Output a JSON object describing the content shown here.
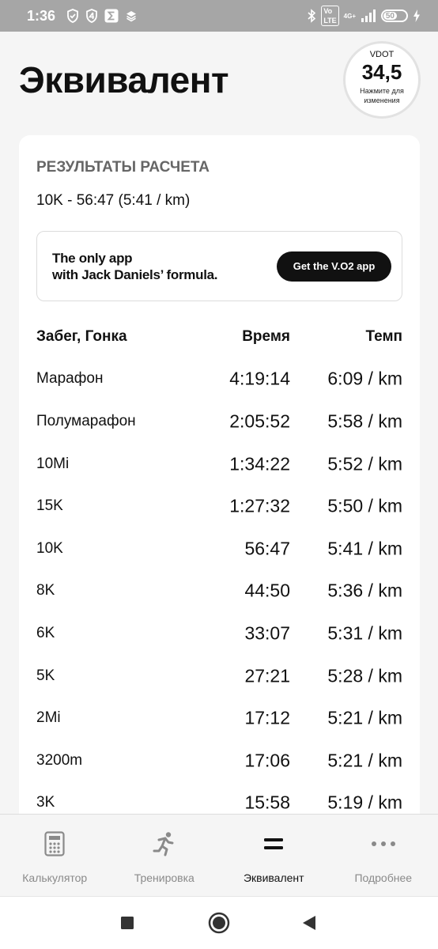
{
  "status_bar": {
    "time": "1:36",
    "network_badge_1": "Vo",
    "network_badge_2": "LTE",
    "signal_label": "4G+",
    "battery": "50"
  },
  "header": {
    "title": "Эквивалент",
    "vdot_label": "VDOT",
    "vdot_value": "34,5",
    "vdot_hint_line1": "Нажмите для",
    "vdot_hint_line2": "изменения"
  },
  "results": {
    "section_title": "РЕЗУЛЬТАТЫ РАСЧЕТА",
    "summary": "10K - 56:47 (5:41 / km)"
  },
  "promo": {
    "line1": "The only app",
    "line2": "with Jack Daniels’ formula.",
    "button_label": "Get the V.O2 app"
  },
  "table": {
    "headers": [
      "Забег, Гонка",
      "Время",
      "Темп"
    ],
    "rows": [
      [
        "Марафон",
        "4:19:14",
        "6:09 / km"
      ],
      [
        "Полумарафон",
        "2:05:52",
        "5:58 / km"
      ],
      [
        "10Mi",
        "1:34:22",
        "5:52 / km"
      ],
      [
        "15K",
        "1:27:32",
        "5:50 / km"
      ],
      [
        "10K",
        "56:47",
        "5:41 / km"
      ],
      [
        "8K",
        "44:50",
        "5:36 / km"
      ],
      [
        "6K",
        "33:07",
        "5:31 / km"
      ],
      [
        "5K",
        "27:21",
        "5:28 / km"
      ],
      [
        "2Mi",
        "17:12",
        "5:21 / km"
      ],
      [
        "3200m",
        "17:06",
        "5:21 / km"
      ],
      [
        "3K",
        "15:58",
        "5:19 / km"
      ]
    ]
  },
  "tabs": [
    {
      "label": "Калькулятор",
      "icon": "calculator-icon"
    },
    {
      "label": "Тренировка",
      "icon": "runner-icon"
    },
    {
      "label": "Эквивалент",
      "icon": "equals-icon"
    },
    {
      "label": "Подробнее",
      "icon": "more-dots-icon"
    }
  ],
  "colors": {
    "status_bar": "#a6a6a6",
    "background": "#f5f5f5",
    "section_title": "#666666",
    "button": "#111111",
    "inactive_tab": "#8a8a8a"
  }
}
